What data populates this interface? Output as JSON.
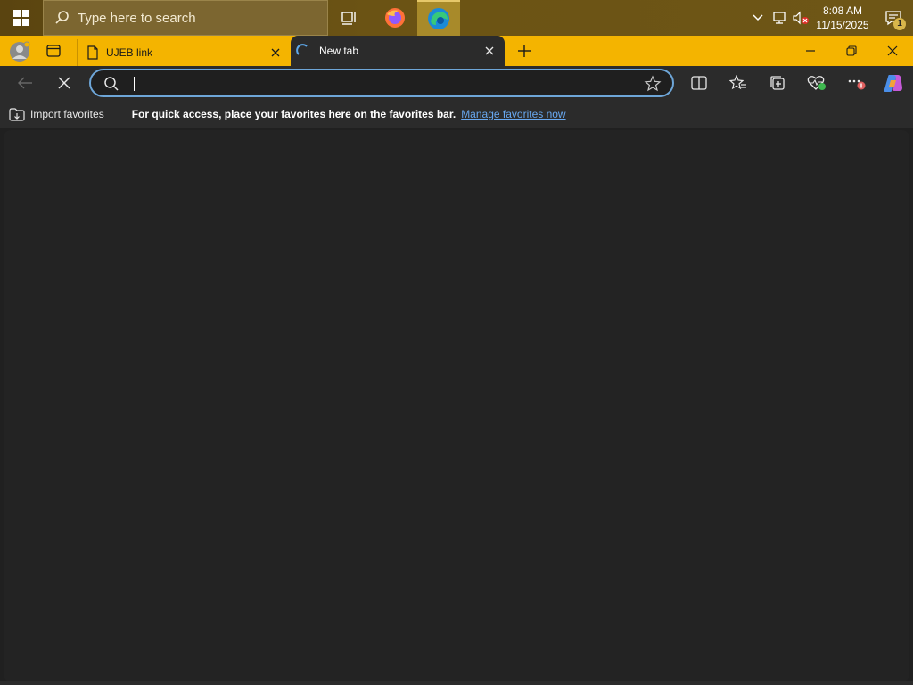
{
  "taskbar": {
    "search_placeholder": "Type here to search",
    "clock_time": "8:08 AM",
    "clock_date": "11/15/2025",
    "notification_count": "1"
  },
  "tabs": [
    {
      "label": "UJEB link",
      "active": false
    },
    {
      "label": "New tab",
      "active": true
    }
  ],
  "omnibox": {
    "value": ""
  },
  "favorites_bar": {
    "import_label": "Import favorites",
    "message": "For quick access, place your favorites here on the favorites bar.",
    "manage_link": "Manage favorites now"
  },
  "colors": {
    "tab_strip": "#f4b400",
    "toolbar": "#2b2b2b",
    "accent_link": "#68a8f0",
    "omnibox_border": "#6ea6d8"
  },
  "icons": [
    "windows-start-icon",
    "search-icon",
    "task-view-icon",
    "firefox-icon",
    "edge-icon",
    "chevron-up-icon",
    "network-icon",
    "volume-muted-icon",
    "notification-icon",
    "profile-icon",
    "tab-actions-icon",
    "page-icon",
    "loading-spinner-icon",
    "close-icon",
    "plus-icon",
    "minimize-icon",
    "restore-icon",
    "back-icon",
    "stop-icon",
    "star-icon",
    "split-screen-icon",
    "favorites-icon",
    "collections-icon",
    "browser-essentials-icon",
    "more-icon",
    "copilot-icon",
    "import-icon"
  ]
}
